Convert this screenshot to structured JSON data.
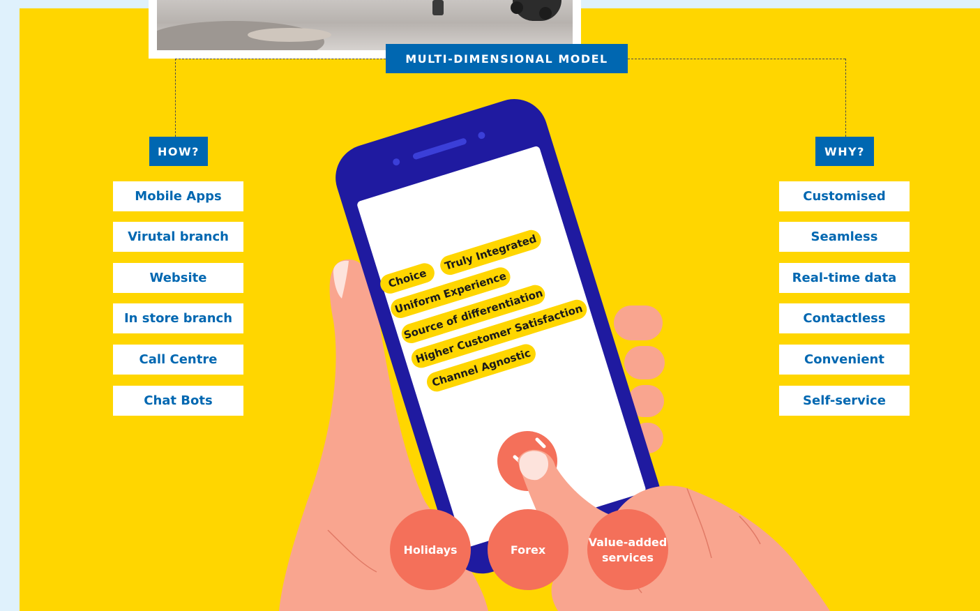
{
  "model_title": "MULTI-DIMENSIONAL MODEL",
  "how": {
    "title": "HOW?",
    "items": [
      "Mobile Apps",
      "Virutal branch",
      "Website",
      "In store branch",
      "Call Centre",
      "Chat Bots"
    ]
  },
  "why": {
    "title": "WHY?",
    "items": [
      "Customised",
      "Seamless",
      "Real-time data",
      "Contactless",
      "Convenient",
      "Self-service"
    ]
  },
  "phone_tags": [
    "Choice",
    "Truly Integrated",
    "Uniform Experience",
    "Source of differentiation",
    "Higher Customer Satisfaction",
    "Channel Agnostic"
  ],
  "circles": {
    "holidays": "Holidays",
    "forex": "Forex",
    "value_added_line1": "Value-added",
    "value_added_line2": "services"
  },
  "colors": {
    "panel_yellow": "#ffd600",
    "brand_blue": "#0067b1",
    "phone_navy": "#1f1aa0",
    "circle_coral": "#f4705a",
    "hand_skin": "#f9a58f"
  }
}
